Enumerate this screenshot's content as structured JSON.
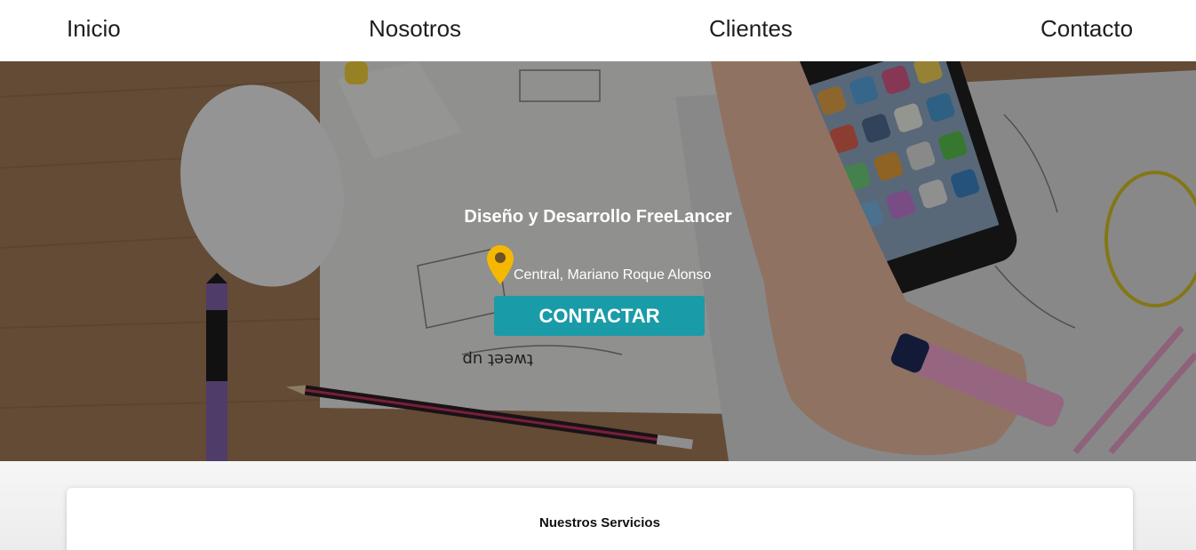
{
  "nav": {
    "items": [
      {
        "label": "Inicio"
      },
      {
        "label": "Nosotros"
      },
      {
        "label": "Clientes"
      },
      {
        "label": "Contacto"
      }
    ]
  },
  "hero": {
    "title": "Diseño y Desarrollo FreeLancer",
    "location": "Central, Mariano Roque Alonso",
    "location_icon": "map-pin-icon",
    "button_label": "CONTACTAR",
    "button_color": "#1a9ba8",
    "pin_color": "#f5b800"
  },
  "services": {
    "title": "Nuestros Servicios"
  }
}
